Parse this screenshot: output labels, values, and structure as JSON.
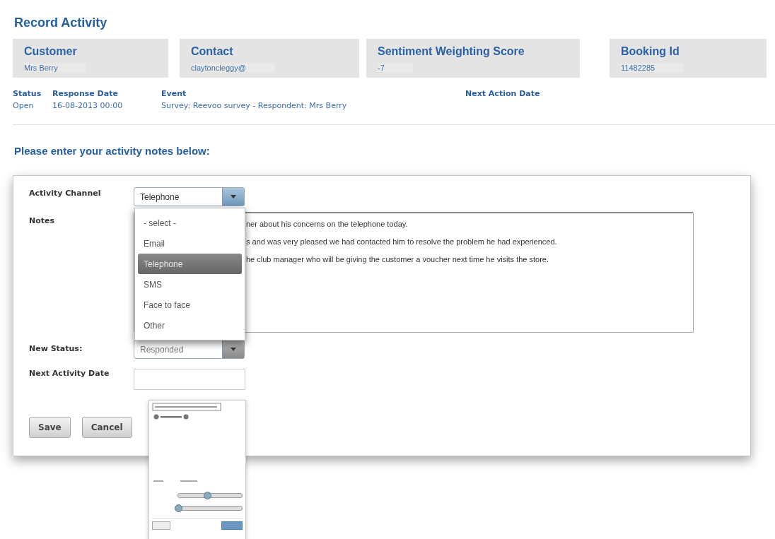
{
  "title": "Record Activity",
  "summary": [
    {
      "label": "Customer",
      "value": "Mrs Berry"
    },
    {
      "label": "Contact",
      "value": "claytoncleggy@"
    },
    {
      "label": "Sentiment Weighting Score",
      "value": "-7"
    },
    {
      "label": "Booking Id",
      "value": "11482285"
    }
  ],
  "details": [
    {
      "label": "Status",
      "value": "Open"
    },
    {
      "label": "Response Date",
      "value": "16-08-2013 00:00"
    },
    {
      "label": "Event",
      "value": "Survey: Reevoo survey - Respondent: Mrs Berry"
    },
    {
      "label": "Next Action Date"
    }
  ],
  "notes_heading": "Please enter your activity notes below:",
  "form": {
    "channel_label": "Activity Channel",
    "channel_value": "Telephone",
    "channel_options": [
      {
        "label": "- select -",
        "selected": false
      },
      {
        "label": "Email",
        "selected": false
      },
      {
        "label": "Telephone",
        "selected": true
      },
      {
        "label": "SMS",
        "selected": false
      },
      {
        "label": "Face to face",
        "selected": false
      },
      {
        "label": "Other",
        "selected": false
      }
    ],
    "notes_label": "Notes",
    "notes_lines": [
      "ner about his concerns on the telephone today.",
      "s and was very pleased we had contacted him to resolve the problem he had experienced.",
      "he club manager who will be giving the customer a voucher next time he visits the store."
    ],
    "status_label": "New Status:",
    "status_value": "Responded",
    "date_label": "Next Activity Date",
    "buttons": [
      "Save",
      "Cancel"
    ]
  },
  "datepicker": {
    "sliders": [
      {
        "level": 0.45
      },
      {
        "level": 0
      }
    ]
  }
}
